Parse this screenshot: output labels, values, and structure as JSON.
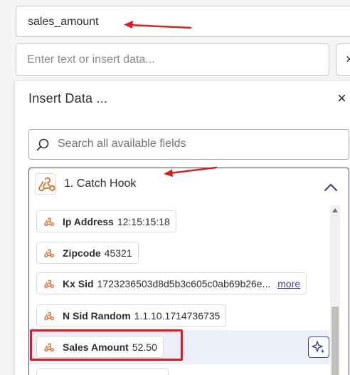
{
  "field_key": "sales_amount",
  "value_input": {
    "placeholder": "Enter text or insert data..."
  },
  "side_close": "×",
  "popover": {
    "title": "Insert Data ...",
    "close": "×",
    "search_placeholder": "Search all available fields",
    "step": {
      "title": "1. Catch Hook"
    },
    "fields": [
      {
        "key": "Ip Address",
        "value": "12:15:15:18"
      },
      {
        "key": "Zipcode",
        "value": "45321"
      },
      {
        "key": "Kx Sid",
        "value": "1723236503d8d5b3c605c0ab69b26e...",
        "more": "more"
      },
      {
        "key": "N Sid Random",
        "value": "1.1.10.1714736735"
      },
      {
        "key": "Sales Amount",
        "value": "52.50"
      }
    ]
  },
  "colors": {
    "accent": "#3d4592",
    "annotation": "#e11b1b",
    "webhook_icon": "#e8692c"
  },
  "icons": [
    "search-icon",
    "webhook-icon",
    "chevron-up-icon",
    "sparkle-icon",
    "close-icon"
  ]
}
